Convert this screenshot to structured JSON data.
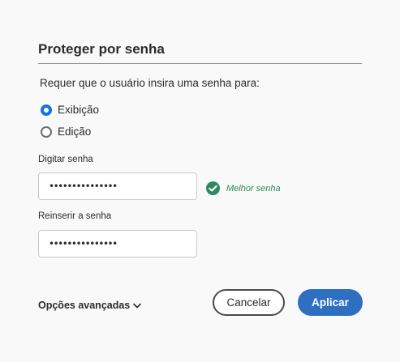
{
  "dialog": {
    "title": "Proteger por senha",
    "prompt": "Requer que o usuário insira uma senha para:"
  },
  "options": [
    {
      "label": "Exibição",
      "selected": true
    },
    {
      "label": "Edição",
      "selected": false
    }
  ],
  "password": {
    "label": "Digitar senha",
    "value": "•••••••••••••••"
  },
  "strength": {
    "icon": "check-circle-icon",
    "text": "Melhor senha",
    "color": "#2d8a5f"
  },
  "confirm": {
    "label": "Reinserir a senha",
    "value": "•••••••••••••••"
  },
  "advanced": {
    "label": "Opções avançadas",
    "icon": "chevron-down-icon"
  },
  "buttons": {
    "cancel": "Cancelar",
    "apply": "Aplicar"
  },
  "colors": {
    "accent": "#1473e6",
    "primary_button": "#2f6fc2"
  }
}
